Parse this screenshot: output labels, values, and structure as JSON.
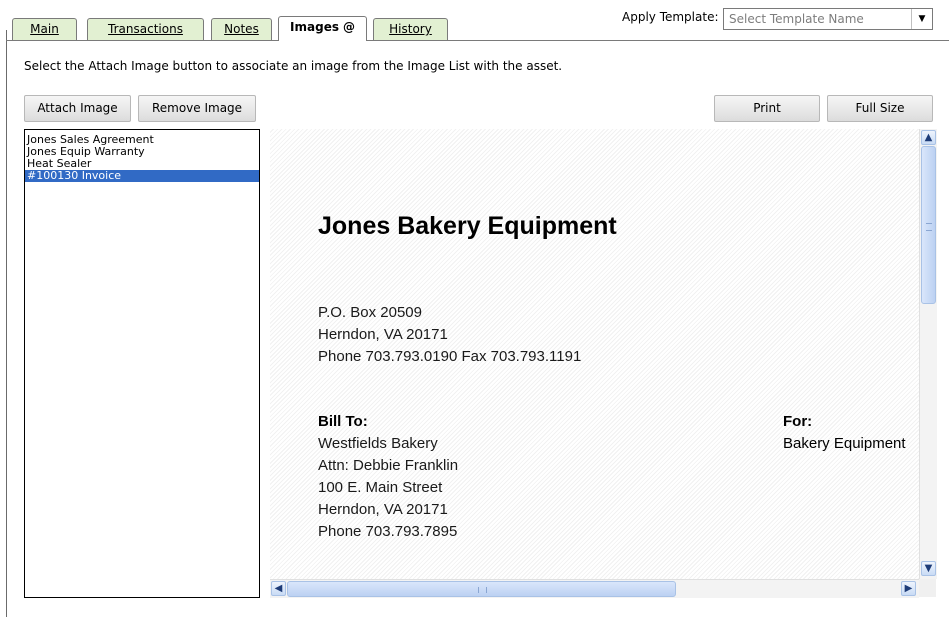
{
  "tabs": [
    {
      "label": "Main",
      "active": false
    },
    {
      "label": "Transactions",
      "active": false
    },
    {
      "label": "Notes",
      "active": false
    },
    {
      "label": "Images",
      "active": true,
      "icon": "paperclip-icon"
    },
    {
      "label": "History",
      "active": false
    }
  ],
  "template": {
    "label": "Apply Template:",
    "placeholder": "Select Template Name",
    "icon": "chevron-down-icon"
  },
  "instruction": "Select the Attach Image button to associate an image from the Image List with the asset.",
  "buttons": {
    "attach": "Attach Image",
    "remove": "Remove Image",
    "print": "Print",
    "full_size": "Full Size"
  },
  "image_list": {
    "items": [
      "Jones Sales Agreement",
      "Jones Equip Warranty",
      "Heat Sealer",
      "#100130 Invoice"
    ],
    "selected_index": 3
  },
  "document": {
    "company": "Jones Bakery Equipment",
    "address": [
      "P.O. Box 20509",
      "Herndon, VA  20171",
      "Phone 703.793.0190   Fax 703.793.1191"
    ],
    "bill_to_label": "Bill To:",
    "bill_to": [
      "Westfields Bakery",
      "Attn:  Debbie Franklin",
      "100 E. Main Street",
      "Herndon, VA  20171",
      "Phone 703.793.7895"
    ],
    "for_label": "For:",
    "for_value": "Bakery Equipment"
  },
  "colors": {
    "tab_background": "#e2f0d2",
    "selection": "#316ac5",
    "scrollbar": "#bcd1f2"
  }
}
